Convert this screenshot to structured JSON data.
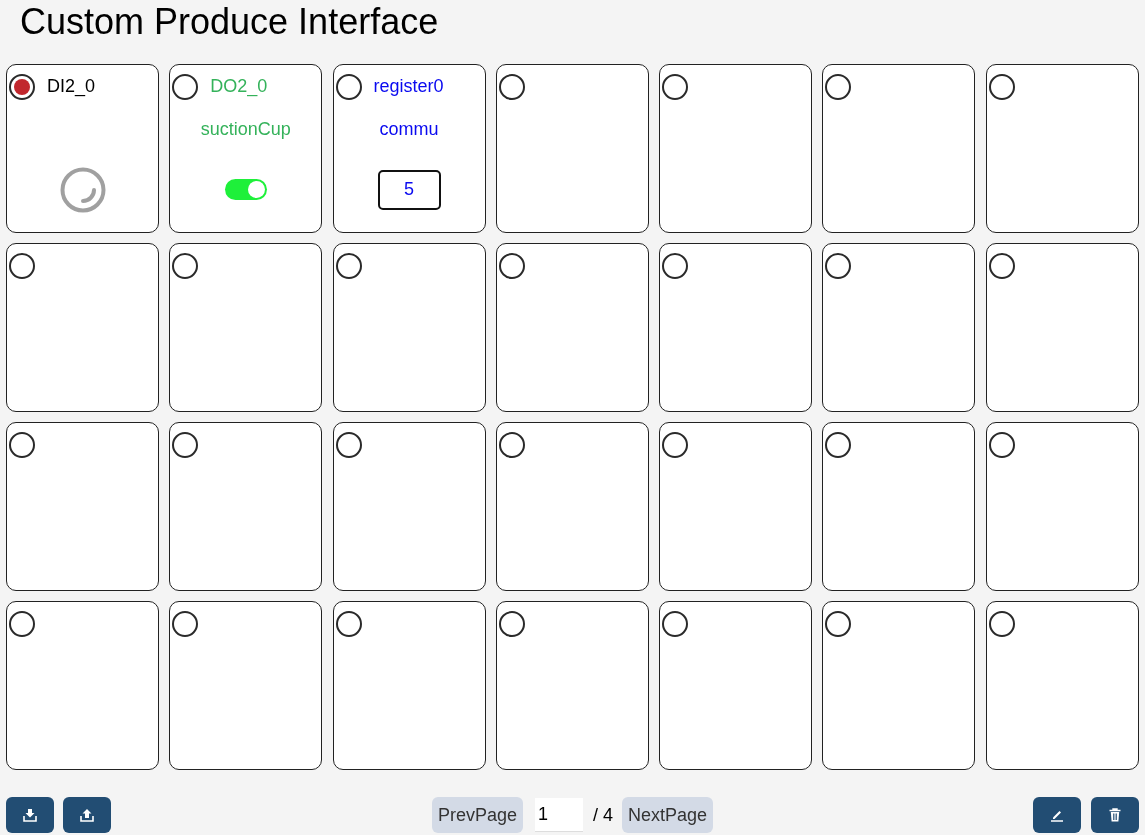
{
  "title": "Custom Produce Interface",
  "cards": [
    {
      "kind": "di",
      "selected": true,
      "name": "DI2_0",
      "on": false
    },
    {
      "kind": "do",
      "selected": false,
      "name": "DO2_0",
      "label": "suctionCup",
      "on": true
    },
    {
      "kind": "register",
      "selected": false,
      "name": "register0",
      "label": "commu",
      "value": "5"
    },
    {
      "kind": "empty",
      "selected": false
    },
    {
      "kind": "empty",
      "selected": false
    },
    {
      "kind": "empty",
      "selected": false
    },
    {
      "kind": "empty",
      "selected": false
    },
    {
      "kind": "empty",
      "selected": false
    },
    {
      "kind": "empty",
      "selected": false
    },
    {
      "kind": "empty",
      "selected": false
    },
    {
      "kind": "empty",
      "selected": false
    },
    {
      "kind": "empty",
      "selected": false
    },
    {
      "kind": "empty",
      "selected": false
    },
    {
      "kind": "empty",
      "selected": false
    },
    {
      "kind": "empty",
      "selected": false
    },
    {
      "kind": "empty",
      "selected": false
    },
    {
      "kind": "empty",
      "selected": false
    },
    {
      "kind": "empty",
      "selected": false
    },
    {
      "kind": "empty",
      "selected": false
    },
    {
      "kind": "empty",
      "selected": false
    },
    {
      "kind": "empty",
      "selected": false
    },
    {
      "kind": "empty",
      "selected": false
    },
    {
      "kind": "empty",
      "selected": false
    },
    {
      "kind": "empty",
      "selected": false
    },
    {
      "kind": "empty",
      "selected": false
    },
    {
      "kind": "empty",
      "selected": false
    },
    {
      "kind": "empty",
      "selected": false
    },
    {
      "kind": "empty",
      "selected": false
    }
  ],
  "pagination": {
    "prev": "PrevPage",
    "page": "1",
    "total": "/ 4",
    "next": "NextPage"
  }
}
